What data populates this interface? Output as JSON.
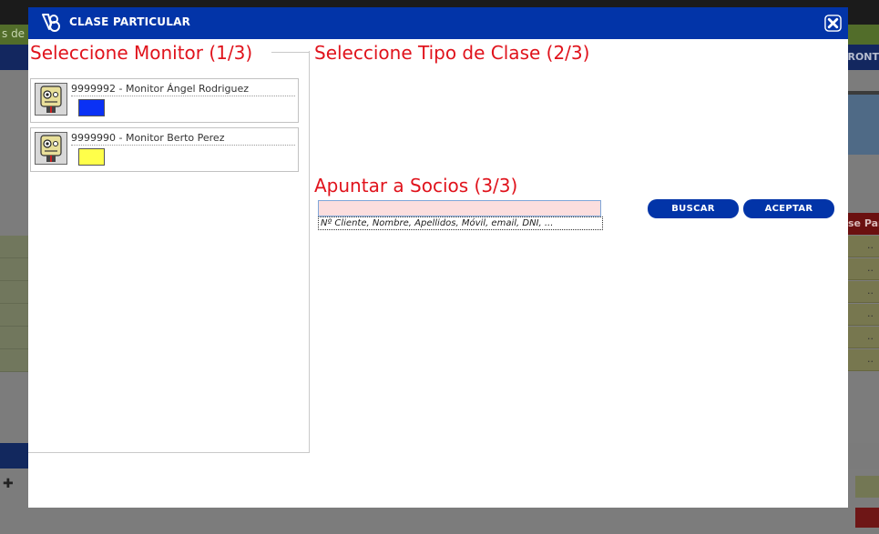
{
  "background": {
    "greenbar_text": "s de p",
    "navbar_text": "FRONT",
    "red_label": "se Par",
    "row_marks": [
      "..",
      "..",
      "..",
      "..",
      "..",
      ".."
    ]
  },
  "modal": {
    "title": "CLASE PARTICULAR",
    "close_icon": "close-icon",
    "colors": {
      "header": "#0234a8",
      "section_title": "#e0131c"
    }
  },
  "step1": {
    "title": "Seleccione Monitor (1/3)",
    "monitors": [
      {
        "label": "9999992 - Monitor Ángel Rodriguez",
        "color": "#0a31f5"
      },
      {
        "label": "9999990 - Monitor Berto Perez",
        "color": "#ffff4a"
      }
    ]
  },
  "step2": {
    "title": "Seleccione Tipo de Clase (2/3)"
  },
  "step3": {
    "title": "Apuntar a Socios (3/3)",
    "search": {
      "value": "",
      "hint": "Nº Cliente, Nombre, Apellidos, Móvil, email, DNI, ..."
    },
    "buscar_label": "BUSCAR",
    "aceptar_label": "ACEPTAR"
  }
}
